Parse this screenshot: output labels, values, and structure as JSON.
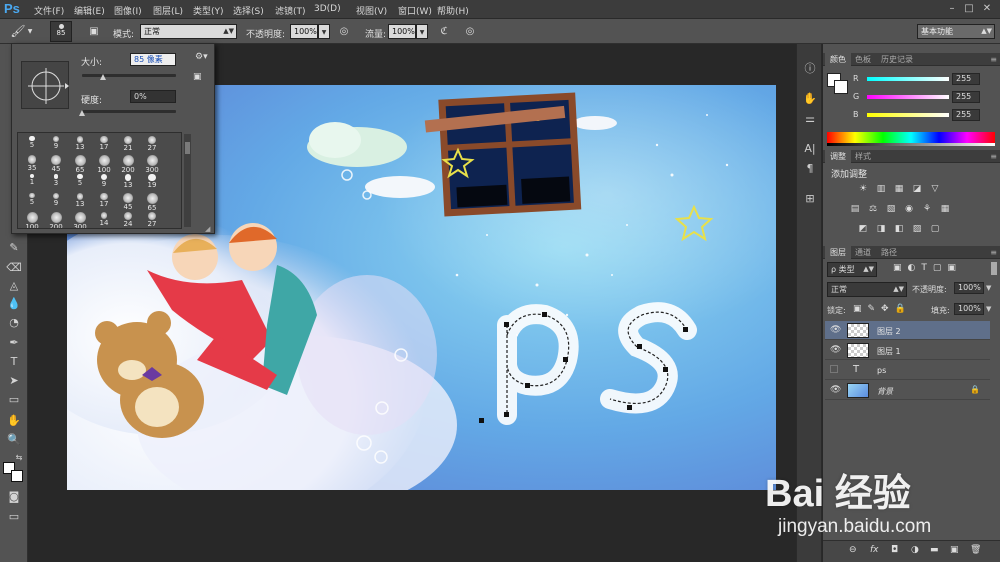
{
  "app": {
    "logo": "Ps"
  },
  "menu": [
    "文件(F)",
    "编辑(E)",
    "图像(I)",
    "图层(L)",
    "类型(Y)",
    "选择(S)",
    "滤镜(T)",
    "3D(D)",
    "视图(V)",
    "窗口(W)",
    "帮助(H)"
  ],
  "window_controls": [
    "–",
    "□",
    "✕"
  ],
  "options_bar": {
    "brush_size": "85",
    "mode_label": "模式:",
    "mode_value": "正常",
    "opacity_label": "不透明度:",
    "opacity_value": "100%",
    "flow_label": "流量:",
    "flow_value": "100%",
    "workspace": "基本功能"
  },
  "brush_popup": {
    "size_label": "大小:",
    "size_value": "85 像素",
    "hardness_label": "硬度:",
    "hardness_value": "0%",
    "size_fraction": 0.22,
    "hardness_fraction": 0.0,
    "presets": [
      [
        "5",
        "9",
        "13",
        "17",
        "21",
        "27"
      ],
      [
        "35",
        "45",
        "65",
        "100",
        "200",
        "300"
      ],
      [
        "1",
        "3",
        "5",
        "9",
        "13",
        "19"
      ],
      [
        "5",
        "9",
        "13",
        "17",
        "45",
        "65"
      ],
      [
        "100",
        "200",
        "300",
        "14",
        "24",
        "27"
      ]
    ]
  },
  "color_panel": {
    "tabs": [
      "颜色",
      "色板",
      "历史记录"
    ],
    "channels": [
      {
        "label": "R",
        "value": "255",
        "color": "#00ffff"
      },
      {
        "label": "G",
        "value": "255",
        "color": "#ff00ff"
      },
      {
        "label": "B",
        "value": "255",
        "color": "#ffff00"
      }
    ]
  },
  "adjust_panel": {
    "tabs": [
      "调整",
      "样式"
    ],
    "title": "添加调整",
    "icons_row1": [
      "☀",
      "▥",
      "▦",
      "◪",
      "▽"
    ],
    "icons_row2": [
      "▤",
      "⚖",
      "▧",
      "◉",
      "⚘",
      "▦"
    ],
    "icons_row3": [
      "◩",
      "◨",
      "◧",
      "▨",
      "▢"
    ]
  },
  "layers_panel": {
    "tabs": [
      "图层",
      "通道",
      "路径"
    ],
    "filter_label": "ρ 类型",
    "blend_mode": "正常",
    "opacity_label": "不透明度:",
    "opacity_value": "100%",
    "lock_label": "锁定:",
    "fill_label": "填充:",
    "fill_value": "100%",
    "layers": [
      {
        "name": "图层 2",
        "type": "pixel",
        "visible": true,
        "selected": true
      },
      {
        "name": "图层 1",
        "type": "pixel",
        "visible": true,
        "selected": false
      },
      {
        "name": "ps",
        "type": "text",
        "visible": false,
        "selected": false
      },
      {
        "name": "背景",
        "type": "background",
        "visible": true,
        "selected": false
      }
    ],
    "footer_icons": [
      "⊖",
      "fx",
      "◘",
      "◑",
      "▬",
      "▣",
      "🗑"
    ]
  },
  "canvas": {
    "text_layer": "ps"
  },
  "watermark": {
    "logo": "Bai 经验",
    "url": "jingyan.baidu.com"
  }
}
